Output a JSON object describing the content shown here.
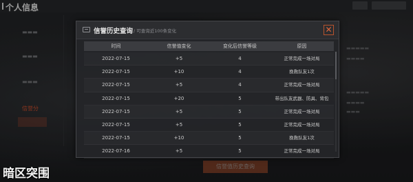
{
  "background": {
    "page_title": "个人信息",
    "side_items": [
      "信誉分",
      "",
      "",
      ""
    ],
    "bottom_button_label": "信誉值历史查询",
    "watermark": "暗区突围"
  },
  "modal": {
    "title": "信誉历史查询",
    "subtitle": "/ 可查询近100条变化",
    "close_label": "✕",
    "table": {
      "headers": [
        "时间",
        "信誉值变化",
        "变化后信誉等级",
        "原因"
      ],
      "rows": [
        [
          "2022-07-15",
          "+5",
          "4",
          "正常完成一场对局"
        ],
        [
          "2022-07-15",
          "+10",
          "4",
          "挽救队友1次"
        ],
        [
          "2022-07-15",
          "+5",
          "4",
          "正常完成一场对局"
        ],
        [
          "2022-07-15",
          "+20",
          "5",
          "带出队友武器、防具、背包"
        ],
        [
          "2022-07-15",
          "+5",
          "5",
          "正常完成一场对局"
        ],
        [
          "2022-07-15",
          "+5",
          "5",
          "正常完成一场对局"
        ],
        [
          "2022-07-15",
          "+10",
          "5",
          "挽救队友1次"
        ],
        [
          "2022-07-16",
          "+5",
          "5",
          "正常完成一场对局"
        ]
      ]
    }
  },
  "colors": {
    "accent": "#b8532d",
    "close_accent": "#e0663a",
    "panel_bg": "#242528",
    "header_row_bg": "#3b3c40"
  },
  "icons": {
    "modal_icon": "history-icon",
    "close_icon": "close-icon"
  }
}
